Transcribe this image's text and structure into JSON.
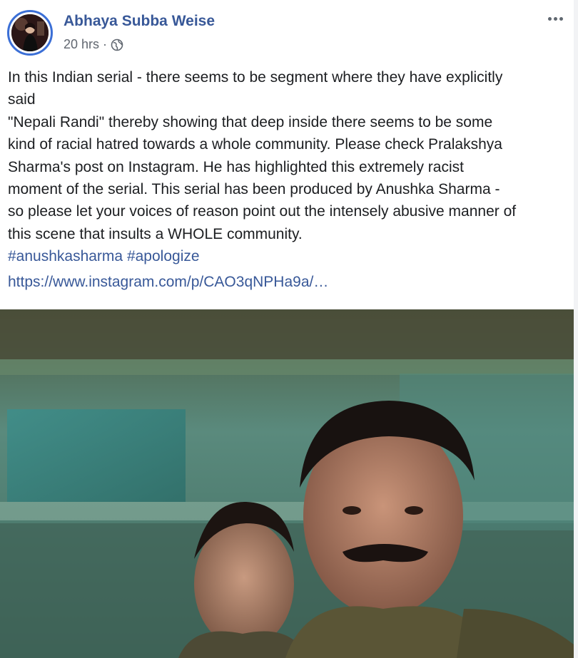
{
  "post": {
    "author": "Abhaya Subba Weise",
    "time": "20 hrs",
    "separator": "·",
    "privacy_icon": "globe-icon",
    "more_icon": "more-options-icon",
    "text_lines": [
      "In this Indian serial - there seems to be segment where they have explicitly",
      "said",
      "\"Nepali Randi\" thereby showing that deep inside there seems to be some",
      "kind of racial hatred towards a whole community. Please check Pralakshya",
      "Sharma's post on Instagram. He has highlighted this extremely racist",
      "moment of the serial. This serial has been produced by Anushka Sharma -",
      "so please let your voices of reason point out the intensely abusive manner of",
      "this scene that insults a WHOLE community."
    ],
    "hashtags": [
      "#anushkasharma",
      "#apologize"
    ],
    "link": "https://www.instagram.com/p/CAO3qNPHa9a/…"
  },
  "colors": {
    "link": "#385898",
    "avatar_ring": "#3b6fd6",
    "text": "#1c1e21",
    "meta": "#616770"
  }
}
